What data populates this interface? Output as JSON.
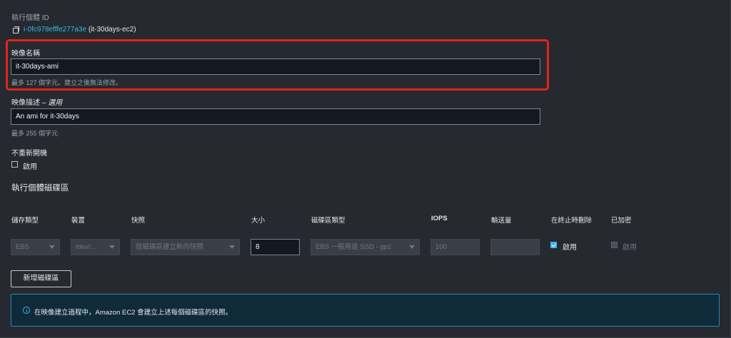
{
  "instance": {
    "label": "執行個體 ID",
    "id": "i-0fc978efffe277a3e",
    "name": "(it-30days-ec2)"
  },
  "image_name": {
    "label": "映像名稱",
    "value": "it-30days-ami",
    "hint": "最多 127 個字元。建立之後無法修改。"
  },
  "image_description": {
    "label": "映像描述 – ",
    "optional": "選用",
    "value": "An ami for it-30days",
    "hint": "最多 255 個字元"
  },
  "no_reboot": {
    "label": "不重新開機",
    "checkbox_label": "啟用",
    "checked": false
  },
  "volumes": {
    "section_title": "執行個體磁碟區",
    "headers": [
      "儲存類型",
      "裝置",
      "快照",
      "大小",
      "磁碟區類型",
      "IOPS",
      "輸送量",
      "在終止時刪除",
      "已加密"
    ],
    "row": {
      "storage_type": "EBS",
      "device": "/dev/...",
      "snapshot": "從磁碟區建立新的快照",
      "size": "8",
      "volume_type": "EBS 一般用途 SSD - gp2",
      "iops": "100",
      "throughput": "",
      "delete_on_termination_label": "啟用",
      "encrypted_label": "啟用"
    },
    "add_button": "新增磁碟區"
  },
  "info_banner": {
    "text": "在映像建立過程中，Amazon EC2 會建立上述每個磁碟區的快照。"
  },
  "colors": {
    "background": "#26292f",
    "accent": "#3bb7e6",
    "highlight_border": "#e0251b",
    "info_bg": "#0f2b3a"
  }
}
